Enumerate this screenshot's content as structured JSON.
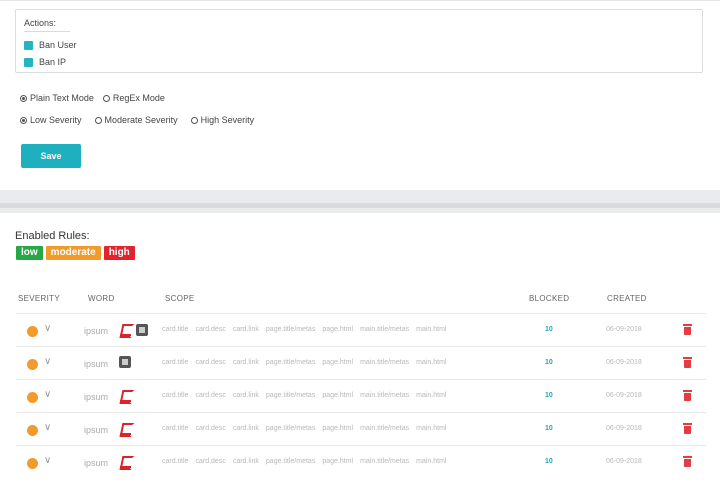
{
  "actions": {
    "title": "Actions:",
    "items": [
      {
        "label": "Ban User",
        "checked": true
      },
      {
        "label": "Ban IP",
        "checked": true
      }
    ]
  },
  "mode": {
    "options": [
      "Plain Text Mode",
      "RegEx Mode"
    ],
    "selected": "Plain Text Mode"
  },
  "severity": {
    "options": [
      "Low Severity",
      "Moderate Severity",
      "High Severity"
    ],
    "selected": "Low Severity"
  },
  "save_label": "Save",
  "rules": {
    "title": "Enabled Rules:",
    "badges": [
      "low",
      "moderate",
      "high"
    ],
    "columns": {
      "severity": "SEVERITY",
      "word": "WORD",
      "scope": "SCOPE",
      "blocked": "BLOCKED",
      "created": "CREATED"
    },
    "scope_labels": [
      "card.title",
      "card.desc",
      "card.link",
      "page.title/metas",
      "page.html",
      "main.title/metas",
      "main.html"
    ],
    "rows": [
      {
        "severity": "moderate",
        "word": "ipsum",
        "icons": [
          "pdf-icon",
          "image-icon"
        ],
        "blocked": "10",
        "created": "06-09-2018"
      },
      {
        "severity": "moderate",
        "word": "ipsum",
        "icons": [
          "image-icon"
        ],
        "blocked": "10",
        "created": "06-09-2018"
      },
      {
        "severity": "moderate",
        "word": "ipsum",
        "icons": [
          "pdf-icon"
        ],
        "blocked": "10",
        "created": "06-09-2018"
      },
      {
        "severity": "moderate",
        "word": "ipsum",
        "icons": [
          "pdf-icon"
        ],
        "blocked": "10",
        "created": "06-09-2018"
      },
      {
        "severity": "moderate",
        "word": "ipsum",
        "icons": [
          "pdf-icon"
        ],
        "blocked": "10",
        "created": "06-09-2018"
      }
    ]
  },
  "colors": {
    "accent": "#1fb0bf",
    "low": "#27a844",
    "moderate": "#f39a2c",
    "high": "#e3242f"
  }
}
